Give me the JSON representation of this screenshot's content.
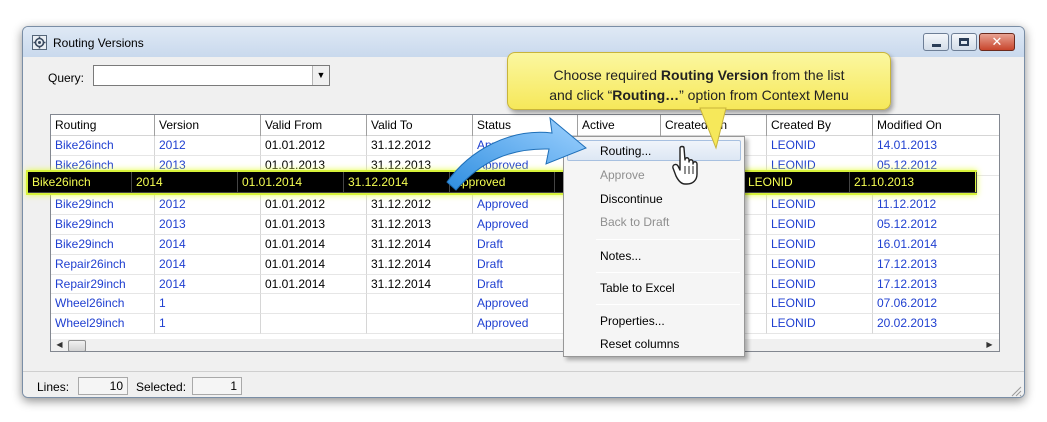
{
  "window": {
    "title": "Routing Versions",
    "icon": "gear-network-icon",
    "controls": [
      "minimize-icon",
      "maximize-icon",
      "close-icon"
    ]
  },
  "query": {
    "label": "Query:",
    "value": ""
  },
  "table": {
    "columns": [
      "Routing",
      "Version",
      "Valid From",
      "Valid To",
      "Status",
      "Active",
      "Created On",
      "Created By",
      "Modified On"
    ],
    "rows": [
      {
        "routing": "Bike26inch",
        "version": "2012",
        "valid_from": "01.01.2012",
        "valid_to": "31.12.2012",
        "status": "Approved",
        "created_by": "LEONID",
        "modified_on": "14.01.2013"
      },
      {
        "routing": "Bike26inch",
        "version": "2013",
        "valid_from": "01.01.2013",
        "valid_to": "31.12.2013",
        "status": "Approved",
        "created_by": "LEONID",
        "modified_on": "05.12.2012"
      },
      {
        "routing": "Bike26inch",
        "version": "2014",
        "valid_from": "01.01.2014",
        "valid_to": "31.12.2014",
        "status": "Approved",
        "created_by": "LEONID",
        "modified_on": "21.10.2013"
      },
      {
        "routing": "Bike29inch",
        "version": "2012",
        "valid_from": "01.01.2012",
        "valid_to": "31.12.2012",
        "status": "Approved",
        "created_by": "LEONID",
        "modified_on": "11.12.2012"
      },
      {
        "routing": "Bike29inch",
        "version": "2013",
        "valid_from": "01.01.2013",
        "valid_to": "31.12.2013",
        "status": "Approved",
        "created_by": "LEONID",
        "modified_on": "05.12.2012"
      },
      {
        "routing": "Bike29inch",
        "version": "2014",
        "valid_from": "01.01.2014",
        "valid_to": "31.12.2014",
        "status": "Draft",
        "created_by": "LEONID",
        "modified_on": "16.01.2014"
      },
      {
        "routing": "Repair26inch",
        "version": "2014",
        "valid_from": "01.01.2014",
        "valid_to": "31.12.2014",
        "status": "Draft",
        "created_by": "LEONID",
        "modified_on": "17.12.2013"
      },
      {
        "routing": "Repair29inch",
        "version": "2014",
        "valid_from": "01.01.2014",
        "valid_to": "31.12.2014",
        "status": "Draft",
        "created_by": "LEONID",
        "modified_on": "17.12.2013"
      },
      {
        "routing": "Wheel26inch",
        "version": "1",
        "valid_from": "",
        "valid_to": "",
        "status": "Approved",
        "created_by": "LEONID",
        "modified_on": "07.06.2012"
      },
      {
        "routing": "Wheel29inch",
        "version": "1",
        "valid_from": "",
        "valid_to": "",
        "status": "Approved",
        "created_by": "LEONID",
        "modified_on": "20.02.2013"
      }
    ]
  },
  "context_menu": {
    "items": [
      {
        "label": "Routing...",
        "enabled": true
      },
      {
        "label": "Approve",
        "enabled": false
      },
      {
        "label": "Discontinue",
        "enabled": true
      },
      {
        "label": "Back to Draft",
        "enabled": false
      },
      {
        "label": "Notes...",
        "enabled": true
      },
      {
        "label": "Table to Excel",
        "enabled": true
      },
      {
        "label": "Properties...",
        "enabled": true
      },
      {
        "label": "Reset columns",
        "enabled": true
      }
    ]
  },
  "statusbar": {
    "lines_label": "Lines:",
    "lines_value": "10",
    "selected_label": "Selected:",
    "selected_value": "1"
  },
  "callout": {
    "part1": "Choose required ",
    "bold1": "Routing Version",
    "part2": " from the list",
    "part3": "and click “",
    "bold2": "Routing…",
    "part4": "” option from Context Menu"
  },
  "colors": {
    "link_blue": "#1f3fd0",
    "selected_bg": "#000000",
    "selected_text": "#f6ff52",
    "callout_bg": "#f8ec6a"
  }
}
